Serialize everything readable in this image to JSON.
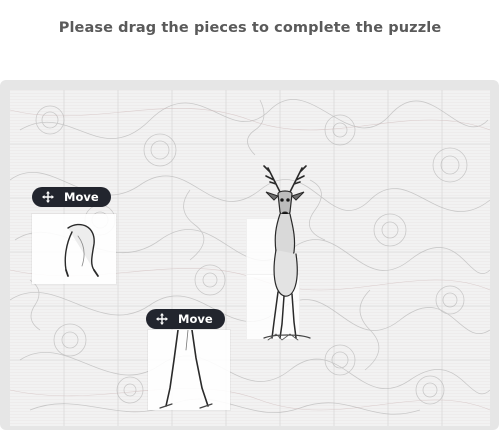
{
  "header": {
    "instruction": "Please drag the pieces to complete the puzzle"
  },
  "pieces": [
    {
      "label": "Move",
      "icon": "move-icon"
    },
    {
      "label": "Move",
      "icon": "move-icon"
    }
  ],
  "colors": {
    "badge_bg": "#22252e",
    "frame_bg": "#e6e6e6",
    "title_text": "#5a5a5a"
  }
}
